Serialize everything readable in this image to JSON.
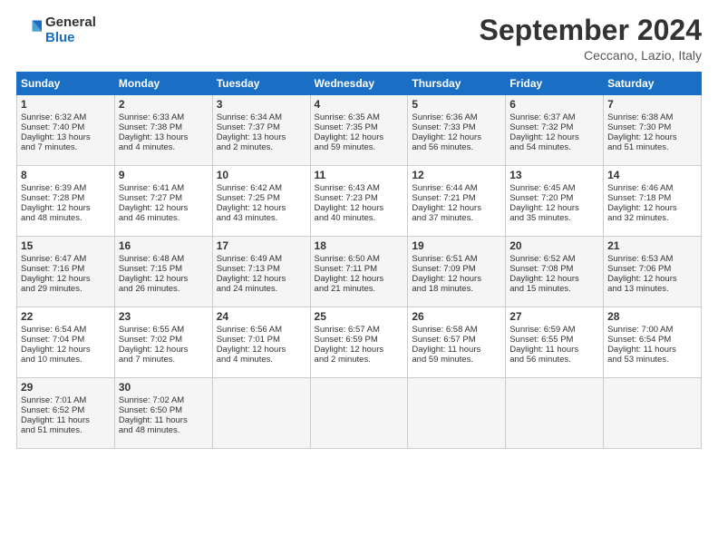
{
  "logo": {
    "line1": "General",
    "line2": "Blue"
  },
  "title": "September 2024",
  "location": "Ceccano, Lazio, Italy",
  "days_of_week": [
    "Sunday",
    "Monday",
    "Tuesday",
    "Wednesday",
    "Thursday",
    "Friday",
    "Saturday"
  ],
  "weeks": [
    [
      {
        "day": "1",
        "lines": [
          "Sunrise: 6:32 AM",
          "Sunset: 7:40 PM",
          "Daylight: 13 hours",
          "and 7 minutes."
        ]
      },
      {
        "day": "2",
        "lines": [
          "Sunrise: 6:33 AM",
          "Sunset: 7:38 PM",
          "Daylight: 13 hours",
          "and 4 minutes."
        ]
      },
      {
        "day": "3",
        "lines": [
          "Sunrise: 6:34 AM",
          "Sunset: 7:37 PM",
          "Daylight: 13 hours",
          "and 2 minutes."
        ]
      },
      {
        "day": "4",
        "lines": [
          "Sunrise: 6:35 AM",
          "Sunset: 7:35 PM",
          "Daylight: 12 hours",
          "and 59 minutes."
        ]
      },
      {
        "day": "5",
        "lines": [
          "Sunrise: 6:36 AM",
          "Sunset: 7:33 PM",
          "Daylight: 12 hours",
          "and 56 minutes."
        ]
      },
      {
        "day": "6",
        "lines": [
          "Sunrise: 6:37 AM",
          "Sunset: 7:32 PM",
          "Daylight: 12 hours",
          "and 54 minutes."
        ]
      },
      {
        "day": "7",
        "lines": [
          "Sunrise: 6:38 AM",
          "Sunset: 7:30 PM",
          "Daylight: 12 hours",
          "and 51 minutes."
        ]
      }
    ],
    [
      {
        "day": "8",
        "lines": [
          "Sunrise: 6:39 AM",
          "Sunset: 7:28 PM",
          "Daylight: 12 hours",
          "and 48 minutes."
        ]
      },
      {
        "day": "9",
        "lines": [
          "Sunrise: 6:41 AM",
          "Sunset: 7:27 PM",
          "Daylight: 12 hours",
          "and 46 minutes."
        ]
      },
      {
        "day": "10",
        "lines": [
          "Sunrise: 6:42 AM",
          "Sunset: 7:25 PM",
          "Daylight: 12 hours",
          "and 43 minutes."
        ]
      },
      {
        "day": "11",
        "lines": [
          "Sunrise: 6:43 AM",
          "Sunset: 7:23 PM",
          "Daylight: 12 hours",
          "and 40 minutes."
        ]
      },
      {
        "day": "12",
        "lines": [
          "Sunrise: 6:44 AM",
          "Sunset: 7:21 PM",
          "Daylight: 12 hours",
          "and 37 minutes."
        ]
      },
      {
        "day": "13",
        "lines": [
          "Sunrise: 6:45 AM",
          "Sunset: 7:20 PM",
          "Daylight: 12 hours",
          "and 35 minutes."
        ]
      },
      {
        "day": "14",
        "lines": [
          "Sunrise: 6:46 AM",
          "Sunset: 7:18 PM",
          "Daylight: 12 hours",
          "and 32 minutes."
        ]
      }
    ],
    [
      {
        "day": "15",
        "lines": [
          "Sunrise: 6:47 AM",
          "Sunset: 7:16 PM",
          "Daylight: 12 hours",
          "and 29 minutes."
        ]
      },
      {
        "day": "16",
        "lines": [
          "Sunrise: 6:48 AM",
          "Sunset: 7:15 PM",
          "Daylight: 12 hours",
          "and 26 minutes."
        ]
      },
      {
        "day": "17",
        "lines": [
          "Sunrise: 6:49 AM",
          "Sunset: 7:13 PM",
          "Daylight: 12 hours",
          "and 24 minutes."
        ]
      },
      {
        "day": "18",
        "lines": [
          "Sunrise: 6:50 AM",
          "Sunset: 7:11 PM",
          "Daylight: 12 hours",
          "and 21 minutes."
        ]
      },
      {
        "day": "19",
        "lines": [
          "Sunrise: 6:51 AM",
          "Sunset: 7:09 PM",
          "Daylight: 12 hours",
          "and 18 minutes."
        ]
      },
      {
        "day": "20",
        "lines": [
          "Sunrise: 6:52 AM",
          "Sunset: 7:08 PM",
          "Daylight: 12 hours",
          "and 15 minutes."
        ]
      },
      {
        "day": "21",
        "lines": [
          "Sunrise: 6:53 AM",
          "Sunset: 7:06 PM",
          "Daylight: 12 hours",
          "and 13 minutes."
        ]
      }
    ],
    [
      {
        "day": "22",
        "lines": [
          "Sunrise: 6:54 AM",
          "Sunset: 7:04 PM",
          "Daylight: 12 hours",
          "and 10 minutes."
        ]
      },
      {
        "day": "23",
        "lines": [
          "Sunrise: 6:55 AM",
          "Sunset: 7:02 PM",
          "Daylight: 12 hours",
          "and 7 minutes."
        ]
      },
      {
        "day": "24",
        "lines": [
          "Sunrise: 6:56 AM",
          "Sunset: 7:01 PM",
          "Daylight: 12 hours",
          "and 4 minutes."
        ]
      },
      {
        "day": "25",
        "lines": [
          "Sunrise: 6:57 AM",
          "Sunset: 6:59 PM",
          "Daylight: 12 hours",
          "and 2 minutes."
        ]
      },
      {
        "day": "26",
        "lines": [
          "Sunrise: 6:58 AM",
          "Sunset: 6:57 PM",
          "Daylight: 11 hours",
          "and 59 minutes."
        ]
      },
      {
        "day": "27",
        "lines": [
          "Sunrise: 6:59 AM",
          "Sunset: 6:55 PM",
          "Daylight: 11 hours",
          "and 56 minutes."
        ]
      },
      {
        "day": "28",
        "lines": [
          "Sunrise: 7:00 AM",
          "Sunset: 6:54 PM",
          "Daylight: 11 hours",
          "and 53 minutes."
        ]
      }
    ],
    [
      {
        "day": "29",
        "lines": [
          "Sunrise: 7:01 AM",
          "Sunset: 6:52 PM",
          "Daylight: 11 hours",
          "and 51 minutes."
        ]
      },
      {
        "day": "30",
        "lines": [
          "Sunrise: 7:02 AM",
          "Sunset: 6:50 PM",
          "Daylight: 11 hours",
          "and 48 minutes."
        ]
      },
      {
        "day": "",
        "lines": []
      },
      {
        "day": "",
        "lines": []
      },
      {
        "day": "",
        "lines": []
      },
      {
        "day": "",
        "lines": []
      },
      {
        "day": "",
        "lines": []
      }
    ]
  ]
}
